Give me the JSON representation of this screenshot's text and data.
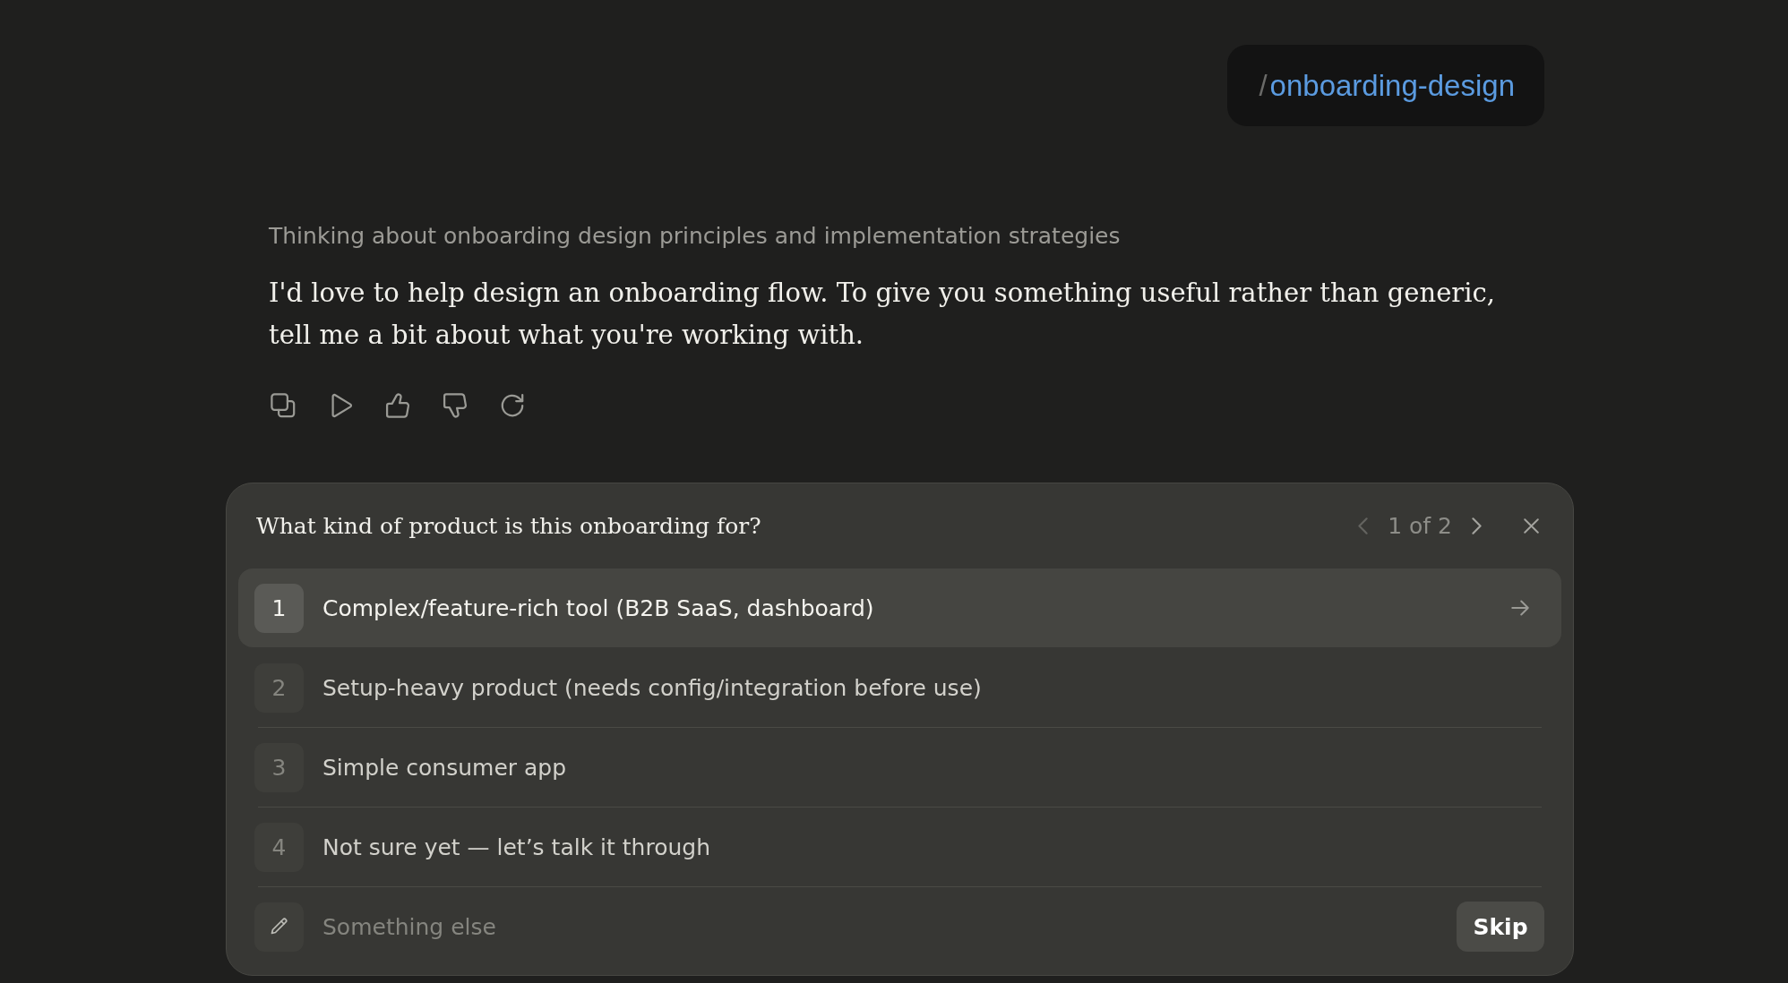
{
  "user_message": {
    "prefix": "/",
    "command": "onboarding-design"
  },
  "reply": {
    "thinking": "Thinking about onboarding design principles and implementation strategies",
    "message": "I'd love to help design an onboarding flow. To give you something useful rather than generic, tell me a bit about what you're working with."
  },
  "question": {
    "title": "What kind of product is this onboarding for?",
    "pager": {
      "text": "1 of 2",
      "prev_disabled": true,
      "next_disabled": false
    },
    "options": [
      {
        "number": "1",
        "label": "Complex/feature-rich tool (B2B SaaS, dashboard)",
        "selected": true
      },
      {
        "number": "2",
        "label": "Setup-heavy product (needs config/integration before use)",
        "selected": false
      },
      {
        "number": "3",
        "label": "Simple consumer app",
        "selected": false
      },
      {
        "number": "4",
        "label": "Not sure yet — let’s talk it through",
        "selected": false
      }
    ],
    "other": {
      "placeholder": "Something else"
    },
    "skip_button": "Skip"
  }
}
